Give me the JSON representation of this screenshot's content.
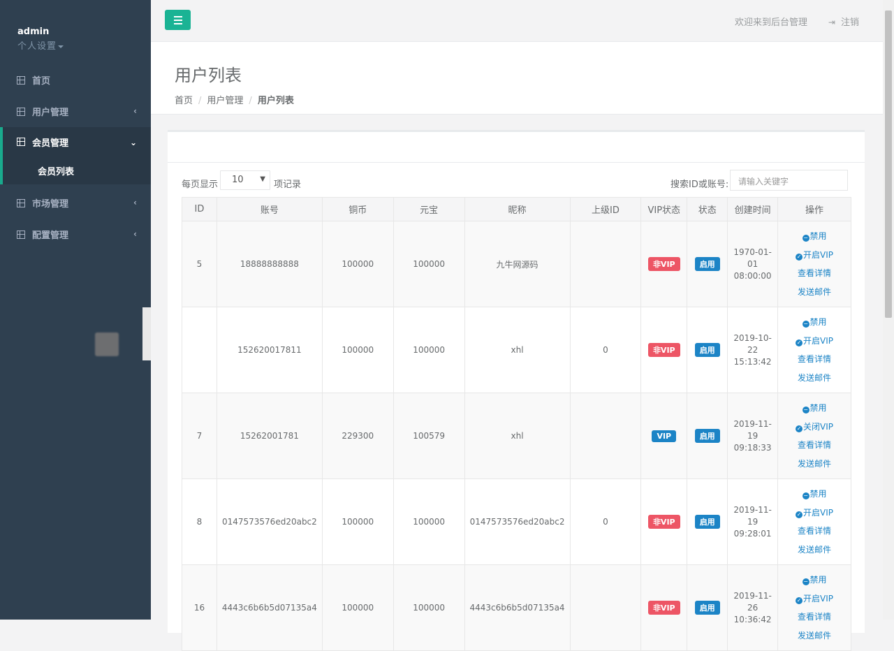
{
  "sidebar": {
    "username": "admin",
    "settings_label": "个人设置",
    "items": [
      {
        "label": "首页",
        "has_arrow": false
      },
      {
        "label": "用户管理",
        "has_arrow": true
      },
      {
        "label": "会员管理",
        "has_arrow": true,
        "active": true
      },
      {
        "label": "市场管理",
        "has_arrow": true
      },
      {
        "label": "配置管理",
        "has_arrow": true
      }
    ],
    "sub_items": [
      {
        "label": "会员列表"
      }
    ]
  },
  "topbar": {
    "welcome": "欢迎来到后台管理",
    "logout": "注销"
  },
  "header": {
    "title": "用户列表",
    "breadcrumb": [
      "首页",
      "用户管理",
      "用户列表"
    ]
  },
  "table_controls": {
    "per_page_label": "每页显示",
    "per_page_value": "10",
    "per_page_suffix": "项记录",
    "search_label": "搜索ID或账号:",
    "search_placeholder": "请输入关键字"
  },
  "table": {
    "columns": [
      "ID",
      "账号",
      "铜币",
      "元宝",
      "昵称",
      "上级ID",
      "VIP状态",
      "状态",
      "创建时间",
      "操作"
    ],
    "rows": [
      {
        "id": "5",
        "account": "18888888888",
        "copper": "100000",
        "ingot": "100000",
        "nickname": "九牛网源码",
        "parent": "",
        "vip": "非VIP",
        "status": "启用",
        "date1": "1970-01-",
        "date2": "01",
        "date3": "08:00:00",
        "op1": "禁用",
        "op2": "开启VIP",
        "op3": "查看详情",
        "op4": "发送邮件"
      },
      {
        "id": "",
        "account": "152620017811",
        "copper": "100000",
        "ingot": "100000",
        "nickname": "xhl",
        "parent": "0",
        "vip": "非VIP",
        "status": "启用",
        "date1": "2019-10-",
        "date2": "22",
        "date3": "15:13:42",
        "op1": "禁用",
        "op2": "开启VIP",
        "op3": "查看详情",
        "op4": "发送邮件"
      },
      {
        "id": "7",
        "account": "15262001781",
        "copper": "229300",
        "ingot": "100579",
        "nickname": "xhl",
        "parent": "",
        "vip": "VIP",
        "status": "启用",
        "date1": "2019-11-",
        "date2": "19",
        "date3": "09:18:33",
        "op1": "禁用",
        "op2": "关闭VIP",
        "op3": "查看详情",
        "op4": "发送邮件"
      },
      {
        "id": "8",
        "account": "0147573576ed20abc2",
        "copper": "100000",
        "ingot": "100000",
        "nickname": "0147573576ed20abc2",
        "parent": "0",
        "vip": "非VIP",
        "status": "启用",
        "date1": "2019-11-",
        "date2": "19",
        "date3": "09:28:01",
        "op1": "禁用",
        "op2": "开启VIP",
        "op3": "查看详情",
        "op4": "发送邮件"
      },
      {
        "id": "16",
        "account": "4443c6b6b5d07135a4",
        "copper": "100000",
        "ingot": "100000",
        "nickname": "4443c6b6b5d07135a4",
        "parent": "",
        "vip": "非VIP",
        "status": "启用",
        "date1": "2019-11-",
        "date2": "26",
        "date3": "10:36:42",
        "op1": "禁用",
        "op2": "开启VIP",
        "op3": "查看详情",
        "op4": "发送邮件"
      }
    ]
  },
  "colors": {
    "sidebar_bg": "#2f4050",
    "accent": "#1ab394",
    "danger": "#ed5565",
    "primary": "#1c84c6"
  }
}
